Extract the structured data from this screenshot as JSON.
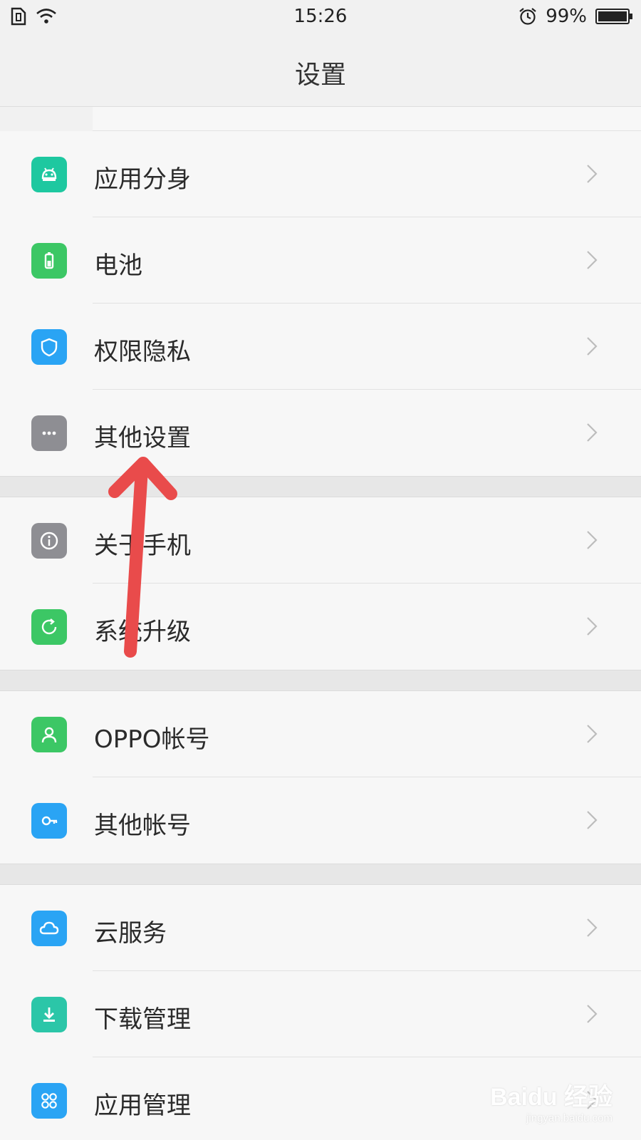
{
  "status_bar": {
    "time": "15:26",
    "battery_percent_text": "99%",
    "battery_level": 0.99,
    "icons": [
      "sim-icon",
      "wifi-icon",
      "alarm-icon",
      "battery-icon"
    ]
  },
  "header": {
    "title": "设置"
  },
  "groups": [
    {
      "items": [
        {
          "label": "应用分身",
          "icon": "android-icon",
          "color": "#1ec8a0"
        },
        {
          "label": "电池",
          "icon": "battery-icon",
          "color": "#3cc765"
        },
        {
          "label": "权限隐私",
          "icon": "shield-icon",
          "color": "#2aa4f4"
        },
        {
          "label": "其他设置",
          "icon": "more-icon",
          "color": "#8e8e93"
        }
      ]
    },
    {
      "items": [
        {
          "label": "关于手机",
          "icon": "info-icon",
          "color": "#8e8e93"
        },
        {
          "label": "系统升级",
          "icon": "update-icon",
          "color": "#3cc765"
        }
      ]
    },
    {
      "items": [
        {
          "label": "OPPO帐号",
          "icon": "person-icon",
          "color": "#3cc765"
        },
        {
          "label": "其他帐号",
          "icon": "key-icon",
          "color": "#2aa4f4"
        }
      ]
    },
    {
      "items": [
        {
          "label": "云服务",
          "icon": "cloud-icon",
          "color": "#2aa4f4"
        },
        {
          "label": "下载管理",
          "icon": "download-icon",
          "color": "#2bc6a8"
        },
        {
          "label": "应用管理",
          "icon": "apps-icon",
          "color": "#2aa4f4"
        }
      ]
    }
  ],
  "annotation": {
    "arrow_color": "#e94b4b",
    "arrow_target": "其他设置"
  },
  "watermark": {
    "main": "Baidu 经验",
    "sub": "jingyan.baidu.com"
  }
}
